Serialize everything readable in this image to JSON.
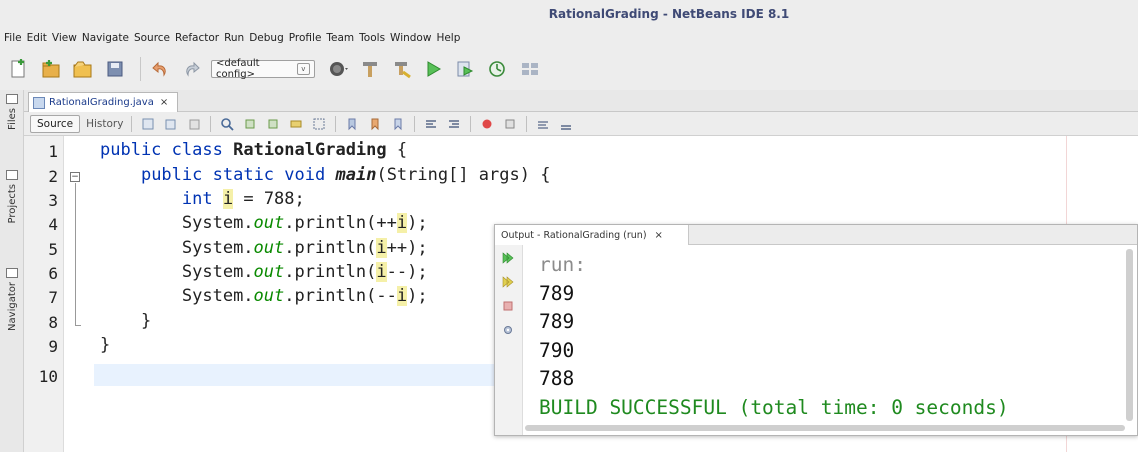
{
  "window": {
    "title": "RationalGrading - NetBeans IDE 8.1"
  },
  "menu": [
    "File",
    "Edit",
    "View",
    "Navigate",
    "Source",
    "Refactor",
    "Run",
    "Debug",
    "Profile",
    "Team",
    "Tools",
    "Window",
    "Help"
  ],
  "toolbar": {
    "config_value": "<default config>",
    "config_arrow": "v"
  },
  "sidebar": {
    "files": "Files",
    "projects": "Projects",
    "navigator": "Navigator"
  },
  "editor_tab": {
    "filename": "RationalGrading.java",
    "close": "×"
  },
  "editor_toolbar": {
    "source": "Source",
    "history": "History"
  },
  "code": {
    "line_numbers": [
      "1",
      "2",
      "3",
      "4",
      "5",
      "6",
      "7",
      "8",
      "9",
      "10"
    ],
    "l1": {
      "kw1": "public",
      "kw2": "class",
      "name": "RationalGrading",
      "rest": " {"
    },
    "l2": {
      "kw1": "public",
      "kw2": "static",
      "kw3": "void",
      "name": "main",
      "rest": "(String[] args) {"
    },
    "l3": {
      "kw": "int",
      "var": "i",
      "rest": " = 788;"
    },
    "l4": {
      "pre": "System.",
      "fld": "out",
      "mid": ".println(++",
      "var": "i",
      "post": ");"
    },
    "l5": {
      "pre": "System.",
      "fld": "out",
      "mid": ".println(",
      "var": "i",
      "post": "++);"
    },
    "l6": {
      "pre": "System.",
      "fld": "out",
      "mid": ".println(",
      "var": "i",
      "post": "--);"
    },
    "l7": {
      "pre": "System.",
      "fld": "out",
      "mid": ".println(--",
      "var": "i",
      "post": ");"
    },
    "l8": "}",
    "l9": "}"
  },
  "output": {
    "tab_label": "Output - RationalGrading (run)",
    "tab_close": "×",
    "lines": [
      "run:",
      "789",
      "789",
      "790",
      "788",
      "BUILD SUCCESSFUL (total time: 0 seconds)"
    ]
  },
  "colors": {
    "keyword": "#0033b3",
    "field": "#0a8a00",
    "highlight": "#f5f0a8",
    "build_ok": "#1f8a1f",
    "current_line": "#e8f2fe"
  }
}
